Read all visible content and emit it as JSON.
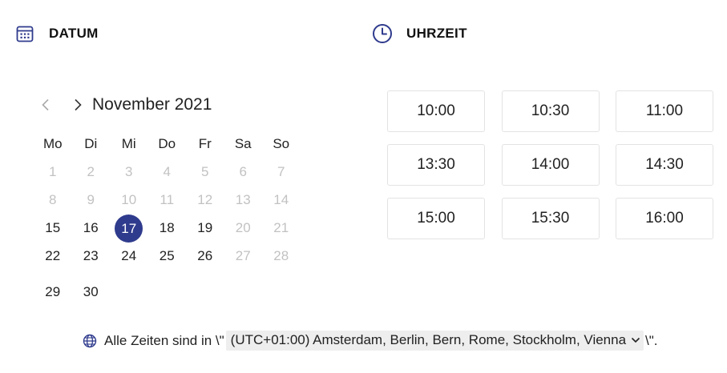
{
  "colors": {
    "accent": "#2f3b8d",
    "disabled_text": "#c2c2c2",
    "slot_border": "#e3e3e3",
    "select_bg": "#eeeeef"
  },
  "date_section": {
    "title": "DATUM",
    "icon": "calendar-icon"
  },
  "time_section": {
    "title": "UHRZEIT",
    "icon": "clock-icon"
  },
  "calendar": {
    "month_label": "November 2021",
    "prev_icon": "chevron-left-icon",
    "next_icon": "chevron-right-icon",
    "weekdays": [
      "Mo",
      "Di",
      "Mi",
      "Do",
      "Fr",
      "Sa",
      "So"
    ],
    "selected_day": "17",
    "weeks": [
      [
        {
          "d": "1",
          "disabled": true
        },
        {
          "d": "2",
          "disabled": true
        },
        {
          "d": "3",
          "disabled": true
        },
        {
          "d": "4",
          "disabled": true
        },
        {
          "d": "5",
          "disabled": true
        },
        {
          "d": "6",
          "disabled": true
        },
        {
          "d": "7",
          "disabled": true
        }
      ],
      [
        {
          "d": "8",
          "disabled": true
        },
        {
          "d": "9",
          "disabled": true
        },
        {
          "d": "10",
          "disabled": true
        },
        {
          "d": "11",
          "disabled": true
        },
        {
          "d": "12",
          "disabled": true
        },
        {
          "d": "13",
          "disabled": true
        },
        {
          "d": "14",
          "disabled": true
        }
      ],
      [
        {
          "d": "15",
          "disabled": false
        },
        {
          "d": "16",
          "disabled": false
        },
        {
          "d": "17",
          "disabled": false,
          "selected": true
        },
        {
          "d": "18",
          "disabled": false
        },
        {
          "d": "19",
          "disabled": false
        },
        {
          "d": "20",
          "disabled": true
        },
        {
          "d": "21",
          "disabled": true
        }
      ],
      [
        {
          "d": "22",
          "disabled": false
        },
        {
          "d": "23",
          "disabled": false
        },
        {
          "d": "24",
          "disabled": false
        },
        {
          "d": "25",
          "disabled": false
        },
        {
          "d": "26",
          "disabled": false
        },
        {
          "d": "27",
          "disabled": true
        },
        {
          "d": "28",
          "disabled": true
        }
      ],
      [
        {
          "d": "29",
          "disabled": false
        },
        {
          "d": "30",
          "disabled": false
        }
      ]
    ]
  },
  "time_slots": [
    "10:00",
    "10:30",
    "11:00",
    "13:30",
    "14:00",
    "14:30",
    "15:00",
    "15:30",
    "16:00"
  ],
  "timezone": {
    "icon": "globe-icon",
    "prefix": "Alle Zeiten sind in \\\"",
    "selected": "(UTC+01:00) Amsterdam, Berlin, Bern, Rome, Stockholm, Vienna",
    "suffix": "\\\"."
  }
}
